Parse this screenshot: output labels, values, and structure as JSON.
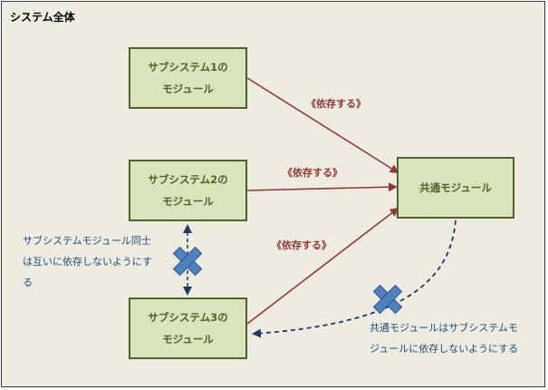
{
  "container": {
    "title": "システム全体"
  },
  "modules": {
    "sub1": {
      "line1": "サブシステム1の",
      "line2": "モジュール"
    },
    "sub2": {
      "line1": "サブシステム2の",
      "line2": "モジュール"
    },
    "sub3": {
      "line1": "サブシステム3の",
      "line2": "モジュール"
    },
    "common": {
      "label": "共通モジュール"
    }
  },
  "dependency_label": "《依存する》",
  "notes": {
    "between_subsystems": [
      "サブシステムモジュール同士",
      "は互いに依存しないようにす",
      "る"
    ],
    "common_to_subsystem": [
      "共通モジュールはサブシステムモ",
      "ジュールに依存しないようにする"
    ]
  },
  "colors": {
    "background": "#eeece1",
    "module_fill": "#d8e4bc",
    "module_border": "#4f6228",
    "dependency_arrow": "#943634",
    "forbidden_arrow": "#1f3864",
    "forbidden_mark": "#4f81bd"
  }
}
